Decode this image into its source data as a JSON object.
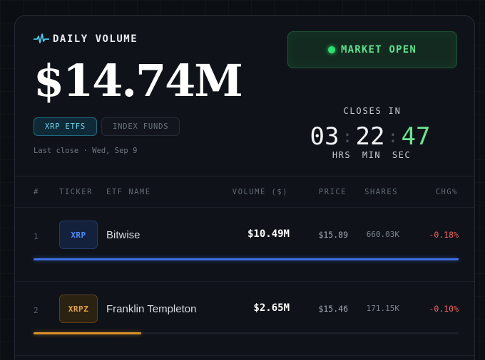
{
  "header": {
    "section_label": "DAILY VOLUME",
    "total_volume": "$14.74M",
    "tabs": [
      {
        "label": "XRP ETFS",
        "active": true
      },
      {
        "label": "INDEX FUNDS",
        "active": false
      }
    ],
    "last_close": "Last close · Wed, Sep 9"
  },
  "market": {
    "status_label": "MARKET OPEN",
    "closes_in_label": "CLOSES IN",
    "hours": "03",
    "minutes": "22",
    "seconds": "47",
    "unit_hours": "HRS",
    "unit_minutes": "MIN",
    "unit_seconds": "SEC"
  },
  "table": {
    "columns": [
      "#",
      "TICKER",
      "ETF NAME",
      "VOLUME ($)",
      "PRICE",
      "SHARES",
      "CHG%"
    ],
    "rows": [
      {
        "rank": "1",
        "ticker": "XRP",
        "name": "Bitwise",
        "volume": "$10.49M",
        "price": "$15.89",
        "shares": "660.03K",
        "chg": "-0.18%",
        "volume_share": 1.0
      },
      {
        "rank": "2",
        "ticker": "XRPZ",
        "name": "Franklin Templeton",
        "volume": "$2.65M",
        "price": "$15.46",
        "shares": "171.15K",
        "chg": "-0.10%",
        "volume_share": 0.253
      }
    ]
  },
  "colors": {
    "accent_cyan": "#6fd3ef",
    "market_green": "#2ee06e",
    "negative_red": "#f0625f",
    "bar_blue": "#3f6fe0",
    "bar_amber": "#d9912f"
  },
  "icons": {
    "pulse": "pulse-icon",
    "status": "status-dot-icon"
  }
}
